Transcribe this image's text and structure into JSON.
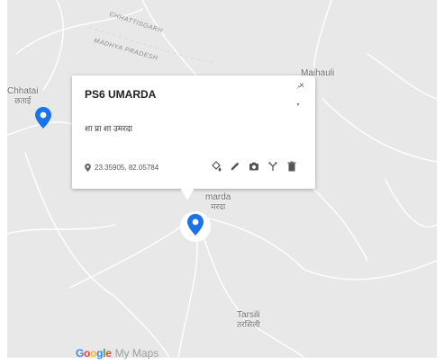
{
  "map": {
    "places": [
      {
        "name": "Chhatai",
        "local": "छताई"
      },
      {
        "name": "Maihauli",
        "local": ""
      },
      {
        "name": "marda",
        "local": "मरदा"
      },
      {
        "name": "Tarsili",
        "local": "तरसिली"
      }
    ],
    "states": [
      "CHHATTISGARH",
      "MADHYA PRADESH"
    ],
    "marker_color": "#1a73e8"
  },
  "popup": {
    "title": "PS6 UMARDA",
    "description": "शा प्रा शा उमरदा",
    "coordinates": "23.35905, 82.05784",
    "close_label": "×",
    "tools": [
      "paint-bucket-icon",
      "edit-pencil-icon",
      "camera-icon",
      "directions-icon",
      "trash-icon"
    ]
  },
  "branding": {
    "google": "Google",
    "product": "My Maps"
  }
}
